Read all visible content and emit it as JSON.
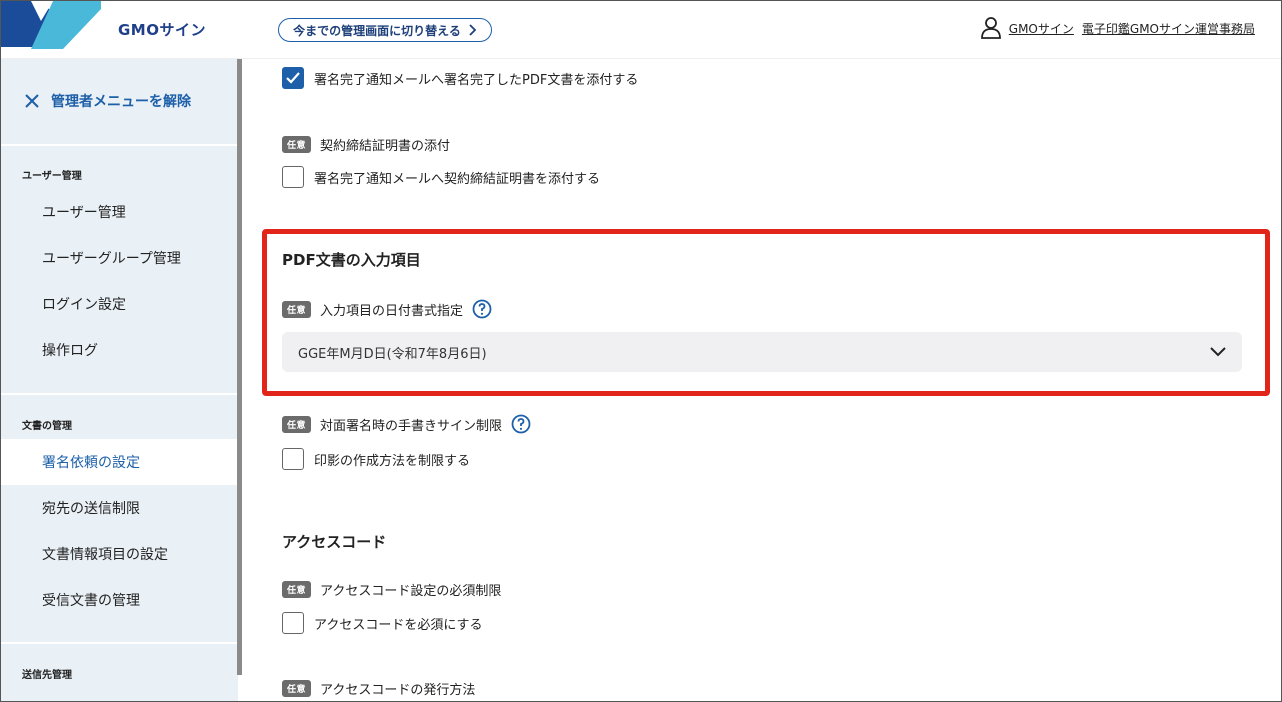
{
  "header": {
    "brand": "GMOサイン",
    "switch_button": "今までの管理画面に切り替える",
    "user_name": "GMOサイン",
    "user_org": "電子印鑑GMOサイン運営事務局"
  },
  "sidebar": {
    "close_label": "管理者メニューを解除",
    "sections": [
      {
        "title": "ユーザー管理",
        "items": [
          "ユーザー管理",
          "ユーザーグループ管理",
          "ログイン設定",
          "操作ログ"
        ]
      },
      {
        "title": "文書の管理",
        "items": [
          "署名依頼の設定",
          "宛先の送信制限",
          "文書情報項目の設定",
          "受信文書の管理"
        ]
      },
      {
        "title": "送信先管理",
        "items": []
      }
    ],
    "active_item": "署名依頼の設定"
  },
  "main": {
    "attach_pdf": {
      "label": "署名完了通知メールへ署名完了したPDF文書を添付する",
      "checked": true
    },
    "contract_cert": {
      "badge": "任意",
      "title": "契約締結証明書の添付",
      "checkbox_label": "署名完了通知メールへ契約締結証明書を添付する",
      "checked": false
    },
    "pdf_inputs": {
      "section_title": "PDF文書の入力項目",
      "badge": "任意",
      "title": "入力項目の日付書式指定",
      "select_value": "GGE年M月D日(令和7年8月6日)"
    },
    "handwritten": {
      "badge": "任意",
      "title": "対面署名時の手書きサイン制限",
      "checkbox_label": "印影の作成方法を制限する",
      "checked": false
    },
    "access_code": {
      "section_title": "アクセスコード",
      "badge": "任意",
      "title": "アクセスコード設定の必須制限",
      "checkbox_label": "アクセスコードを必須にする",
      "checked": false,
      "issue_badge": "任意",
      "issue_title": "アクセスコードの発行方法"
    }
  },
  "colors": {
    "accent": "#1d5fa8",
    "highlight": "#e1251b",
    "sidebar_bg": "#e9f0f6"
  }
}
